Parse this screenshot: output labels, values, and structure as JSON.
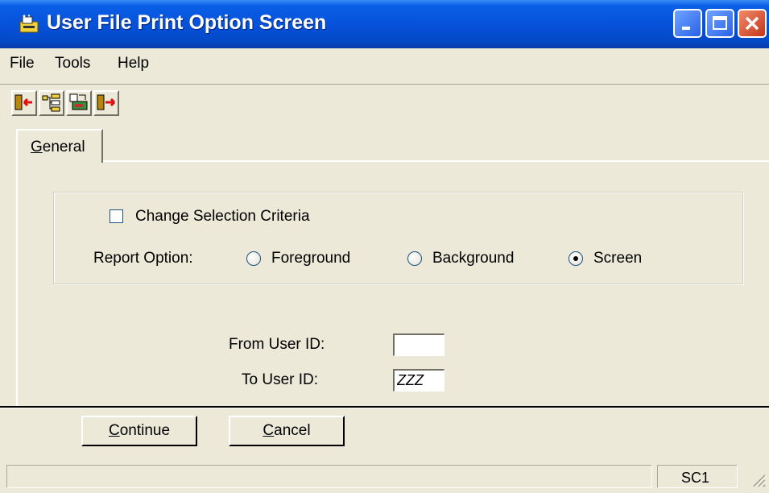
{
  "window": {
    "title": "User File Print Option Screen"
  },
  "menu": {
    "items": [
      {
        "label": "File"
      },
      {
        "label": "Tools"
      },
      {
        "label": "Help"
      }
    ]
  },
  "toolbar": {
    "buttons": [
      {
        "icon": "exit-left-icon"
      },
      {
        "icon": "tree-icon"
      },
      {
        "icon": "printer-icon"
      },
      {
        "icon": "exit-right-icon"
      }
    ]
  },
  "tabs": [
    {
      "label_prefix": "",
      "label_underline": "G",
      "label_rest": "eneral",
      "active": true
    }
  ],
  "options": {
    "change_selection_label": "Change Selection Criteria",
    "change_selection_checked": false,
    "report_option_label": "Report Option:",
    "report_options": [
      {
        "label": "Foreground",
        "checked": false
      },
      {
        "label": "Background",
        "checked": false
      },
      {
        "label": "Screen",
        "checked": true
      }
    ]
  },
  "fields": {
    "from_user_id_label": "From User ID:",
    "from_user_id_value": "",
    "to_user_id_label": "To User ID:",
    "to_user_id_value": "ZZZ"
  },
  "buttons": {
    "continue_underline": "C",
    "continue_rest": "ontinue",
    "cancel_prefix": "",
    "cancel_underline": "C",
    "cancel_rest": "ancel"
  },
  "status": {
    "message": "",
    "code": "SC1"
  },
  "colors": {
    "titlebar": "#0651d8",
    "window_bg": "#ece9d8"
  }
}
